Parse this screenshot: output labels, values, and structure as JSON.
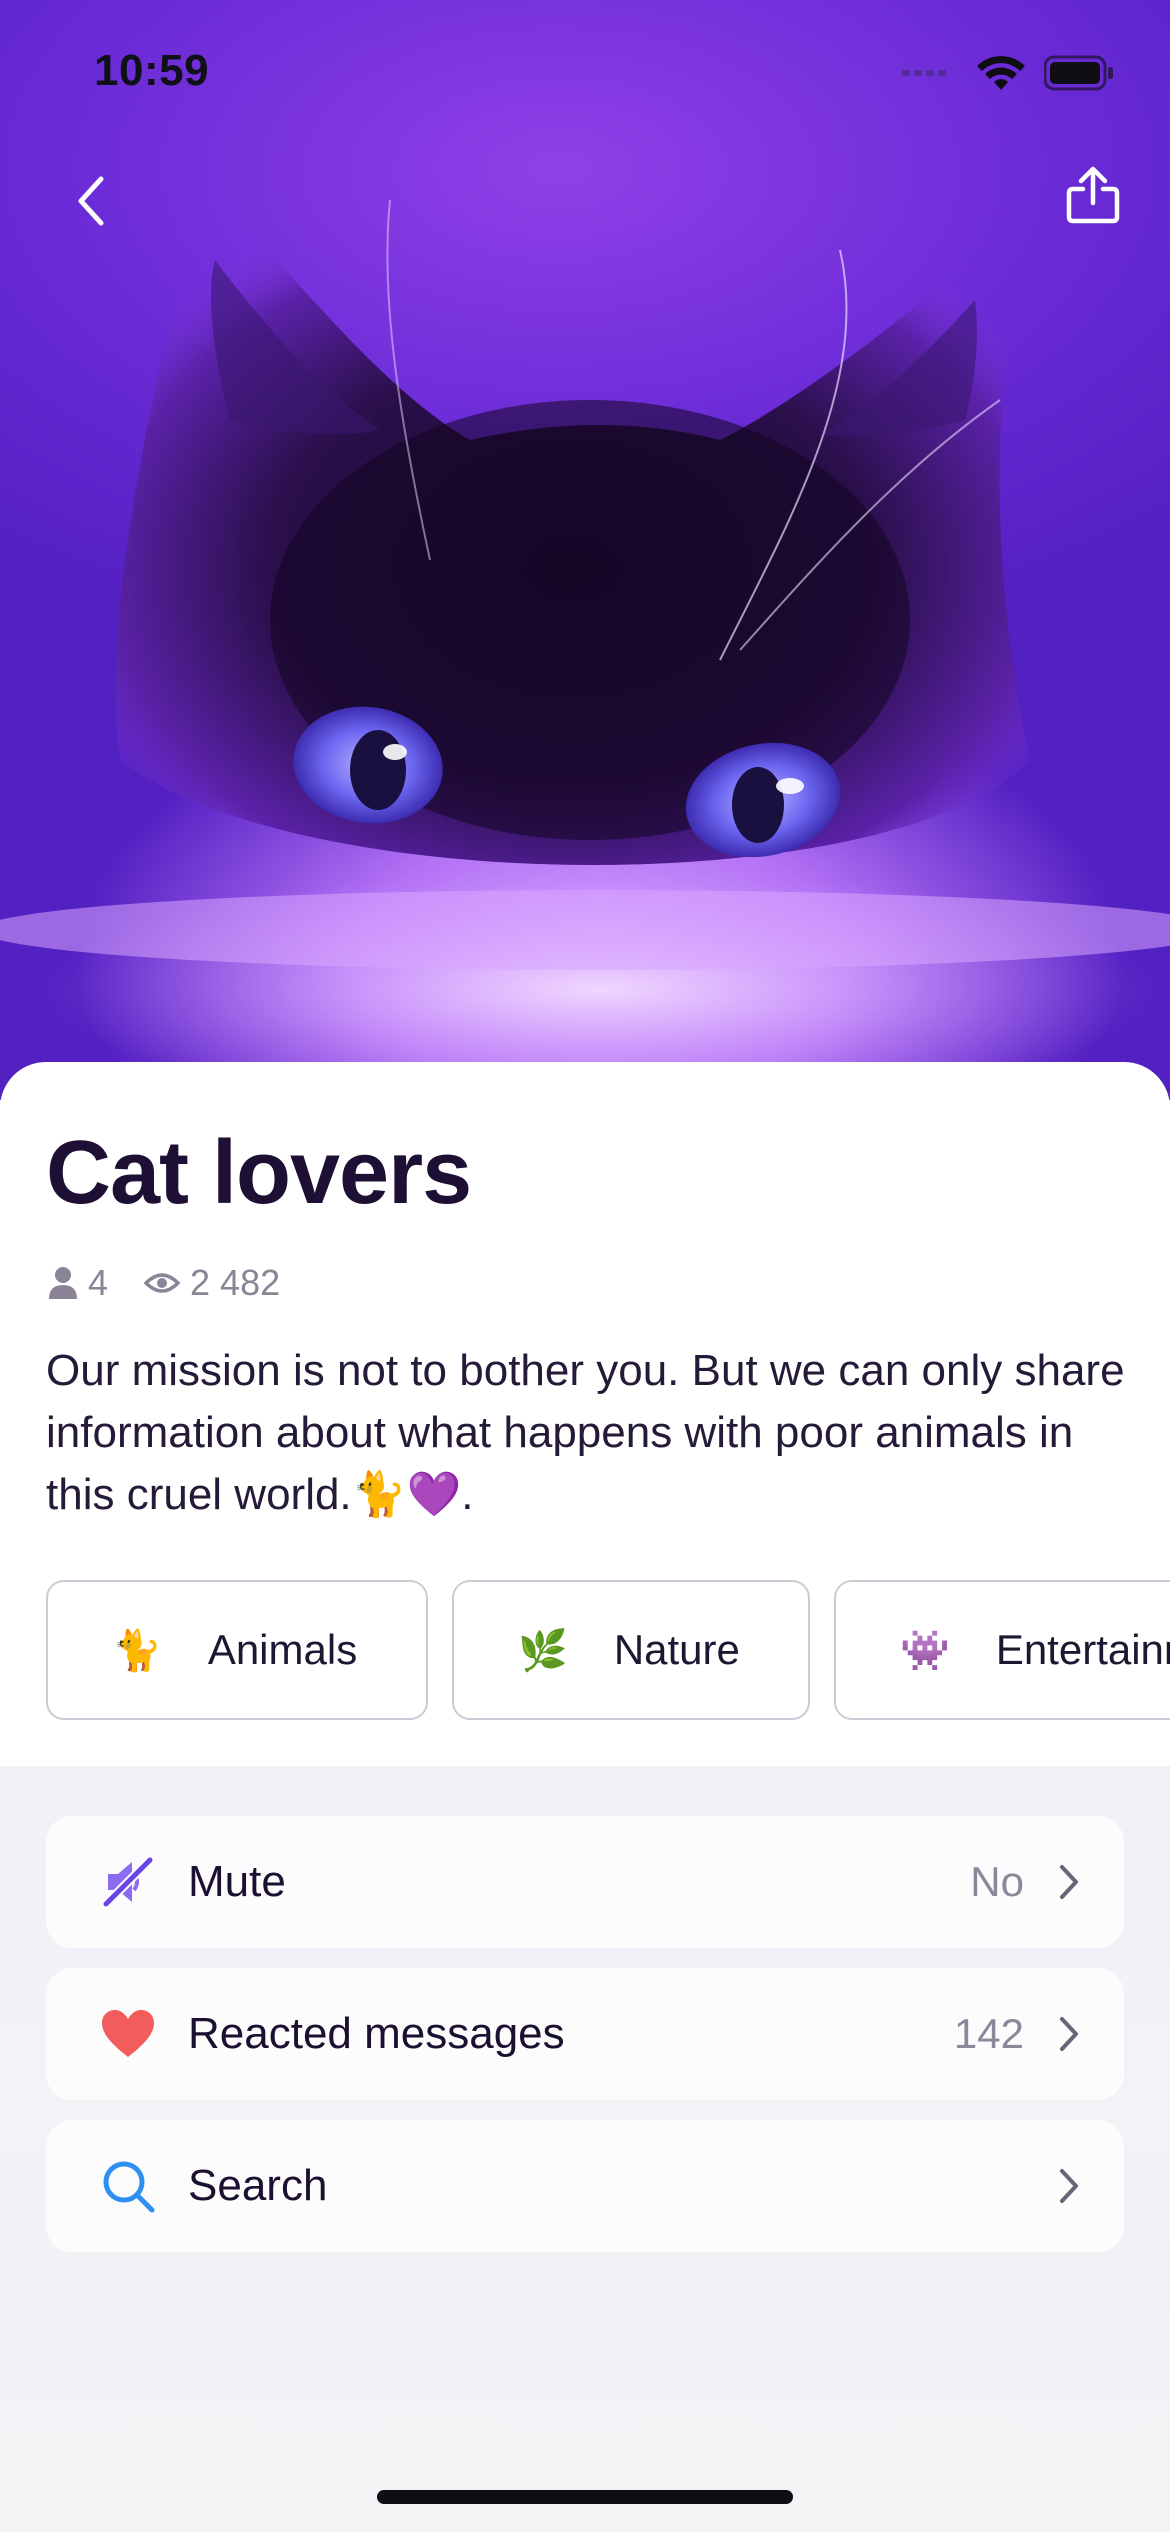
{
  "status_bar": {
    "time": "10:59"
  },
  "header": {
    "back_label": "Back",
    "share_label": "Share"
  },
  "channel": {
    "title": "Cat lovers",
    "members_count": "4",
    "views_count": "2 482",
    "description": "Our mission is not to bother you. But we can only share information about what happens with poor animals in this cruel world.🐈💜."
  },
  "tags": [
    {
      "emoji": "🐈",
      "label": "Animals"
    },
    {
      "emoji": "🌿",
      "label": "Nature"
    },
    {
      "emoji": "👾",
      "label": "Entertainment"
    }
  ],
  "settings": {
    "mute": {
      "label": "Mute",
      "value": "No"
    },
    "reacted": {
      "label": "Reacted messages",
      "value": "142"
    },
    "search": {
      "label": "Search",
      "value": ""
    }
  },
  "colors": {
    "accent": "#7b4cf0",
    "heart": "#f25c5c",
    "search": "#2f8ff0",
    "title": "#1e0f35"
  }
}
